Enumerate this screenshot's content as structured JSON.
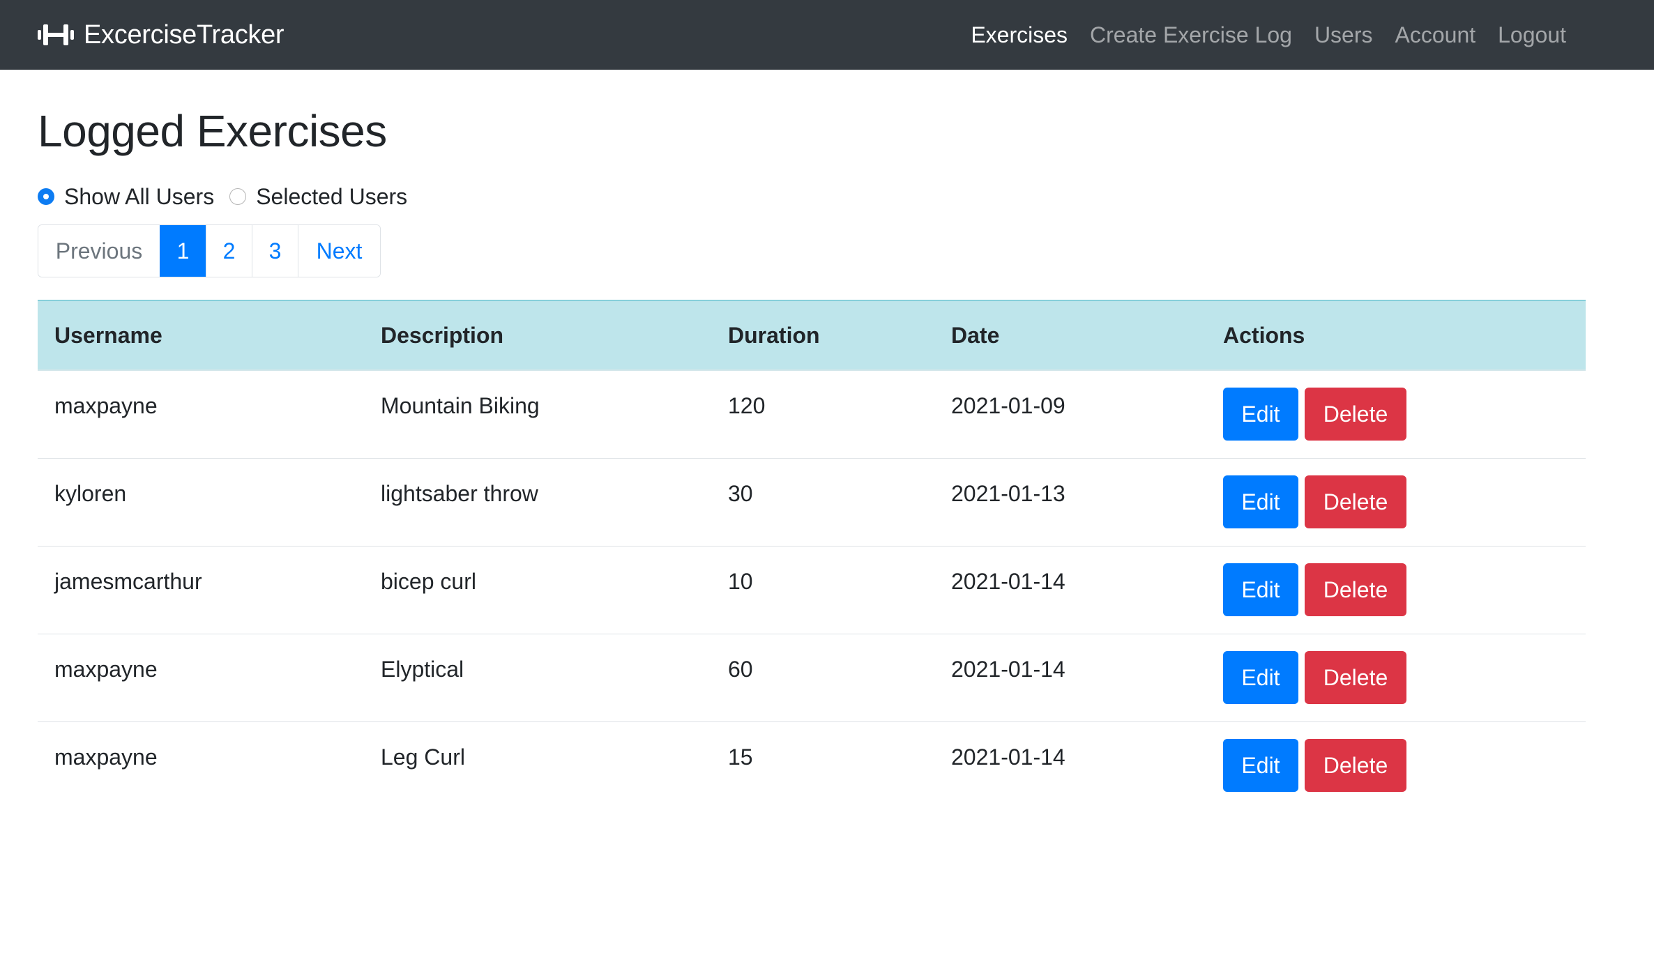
{
  "navbar": {
    "brand": "ExcerciseTracker",
    "brand_icon": "dumbbell-icon",
    "links": [
      {
        "label": "Exercises",
        "active": true
      },
      {
        "label": "Create Exercise Log",
        "active": false
      },
      {
        "label": "Users",
        "active": false
      },
      {
        "label": "Account",
        "active": false
      },
      {
        "label": "Logout",
        "active": false
      }
    ],
    "background_color": "#343a40"
  },
  "main": {
    "title": "Logged Exercises",
    "filters": [
      {
        "label": "Show All Users",
        "checked": true
      },
      {
        "label": "Selected Users",
        "checked": false
      }
    ],
    "pagination": {
      "previous": "Previous",
      "pages": [
        "1",
        "2",
        "3"
      ],
      "current": "1",
      "next": "Next"
    },
    "table": {
      "header_color": "#bee5eb",
      "columns": [
        "Username",
        "Description",
        "Duration",
        "Date",
        "Actions"
      ],
      "rows": [
        {
          "username": "maxpayne",
          "description": "Mountain Biking",
          "duration": "120",
          "date": "2021-01-09"
        },
        {
          "username": "kyloren",
          "description": "lightsaber throw",
          "duration": "30",
          "date": "2021-01-13"
        },
        {
          "username": "jamesmcarthur",
          "description": "bicep curl",
          "duration": "10",
          "date": "2021-01-14"
        },
        {
          "username": "maxpayne",
          "description": "Elyptical",
          "duration": "60",
          "date": "2021-01-14"
        },
        {
          "username": "maxpayne",
          "description": "Leg Curl",
          "duration": "15",
          "date": "2021-01-14"
        }
      ],
      "edit_label": "Edit",
      "delete_label": "Delete",
      "edit_color": "#007bff",
      "delete_color": "#dc3545"
    }
  }
}
